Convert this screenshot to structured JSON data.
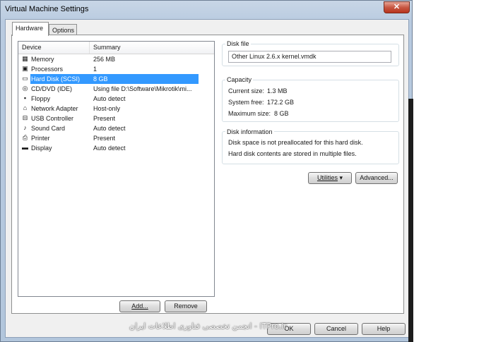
{
  "window": {
    "title": "Virtual Machine Settings",
    "close_glyph": "✕"
  },
  "tabs": [
    {
      "label": "Hardware"
    },
    {
      "label": "Options"
    }
  ],
  "device_list": {
    "headers": {
      "device": "Device",
      "summary": "Summary"
    },
    "items": [
      {
        "name": "Memory",
        "summary": "256 MB",
        "icon": "memory-icon",
        "glyph": "▦"
      },
      {
        "name": "Processors",
        "summary": "1",
        "icon": "processor-icon",
        "glyph": "▣"
      },
      {
        "name": "Hard Disk (SCSI)",
        "summary": "8 GB",
        "icon": "hard-disk-icon",
        "glyph": "▭",
        "selected": true
      },
      {
        "name": "CD/DVD (IDE)",
        "summary": "Using file D:\\Software\\Mikrotik\\mi...",
        "icon": "cd-dvd-icon",
        "glyph": "◎"
      },
      {
        "name": "Floppy",
        "summary": "Auto detect",
        "icon": "floppy-icon",
        "glyph": "▪"
      },
      {
        "name": "Network Adapter",
        "summary": "Host-only",
        "icon": "network-adapter-icon",
        "glyph": "⌂"
      },
      {
        "name": "USB Controller",
        "summary": "Present",
        "icon": "usb-controller-icon",
        "glyph": "⊟"
      },
      {
        "name": "Sound Card",
        "summary": "Auto detect",
        "icon": "sound-card-icon",
        "glyph": "♪"
      },
      {
        "name": "Printer",
        "summary": "Present",
        "icon": "printer-icon",
        "glyph": "⎙"
      },
      {
        "name": "Display",
        "summary": "Auto detect",
        "icon": "display-icon",
        "glyph": "▬"
      }
    ]
  },
  "list_buttons": {
    "add": "Add...",
    "remove": "Remove"
  },
  "disk_file": {
    "label": "Disk file",
    "value": "Other Linux 2.6.x kernel.vmdk"
  },
  "capacity": {
    "label": "Capacity",
    "current_size_label": "Current size:",
    "current_size": "1.3 MB",
    "system_free_label": "System free:",
    "system_free": "172.2 GB",
    "maximum_size_label": "Maximum size:",
    "maximum_size": "8 GB"
  },
  "disk_information": {
    "label": "Disk information",
    "line1": "Disk space is not preallocated for this hard disk.",
    "line2": "Hard disk contents are stored in multiple files."
  },
  "action_buttons": {
    "utilities": "Utilities",
    "utilities_arrow": "▾",
    "advanced": "Advanced..."
  },
  "dialog_buttons": {
    "ok": "OK",
    "cancel": "Cancel",
    "help": "Help"
  },
  "watermark": "ITPro.ir - انجمن تخصصی فناوری اطلاعات ایران",
  "colors": {
    "selection": "#3399ff",
    "close_button": "#c75843",
    "title_bar": "#c8d6e6"
  }
}
